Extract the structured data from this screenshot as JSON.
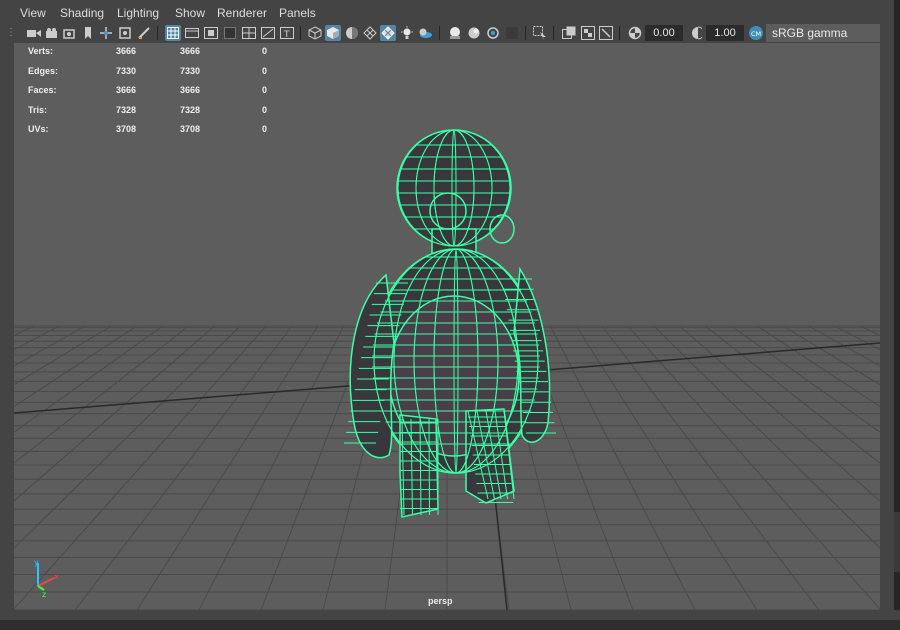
{
  "menu": [
    "View",
    "Shading",
    "Lighting",
    "Show",
    "Renderer",
    "Panels"
  ],
  "toolbar": {
    "exposure_value": "0.00",
    "gamma_value": "1.00",
    "colorspace_label": "sRGB gamma"
  },
  "hud": {
    "rows": [
      {
        "label": "Verts:",
        "values": [
          "3666",
          "3666",
          "0"
        ]
      },
      {
        "label": "Edges:",
        "values": [
          "7330",
          "7330",
          "0"
        ]
      },
      {
        "label": "Faces:",
        "values": [
          "3666",
          "3666",
          "0"
        ]
      },
      {
        "label": "Tris:",
        "values": [
          "7328",
          "7328",
          "0"
        ]
      },
      {
        "label": "UVs:",
        "values": [
          "3708",
          "3708",
          "0"
        ]
      }
    ]
  },
  "camera_label": "persp",
  "axis": {
    "x": "x",
    "y": "y",
    "z": "z"
  },
  "colors": {
    "wireframe": "#3dffa7",
    "viewport_bg": "#5d5d5d",
    "panel_bg": "#444444",
    "active_button": "#5285a6"
  }
}
